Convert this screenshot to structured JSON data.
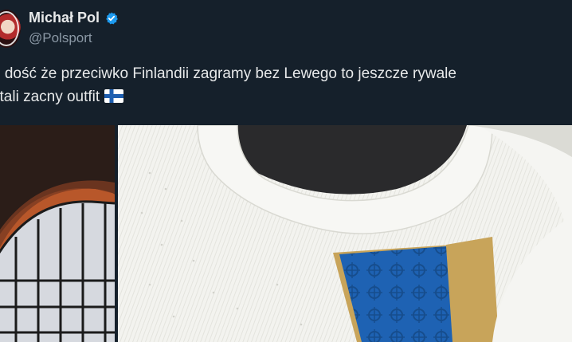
{
  "author": {
    "name": "Michał Pol",
    "handle": "@Polsport",
    "verified": true,
    "verified_color": "#1d9bf0"
  },
  "tweet": {
    "line1": "e dość że przeciwko Finlandii zagramy bez Lewego to jeszcze rywale",
    "line2": "stali zacny outfit",
    "emoji": "flag-finland-icon"
  },
  "media": {
    "images": [
      "church-window-photo",
      "finland-jersey-collar-photo"
    ]
  },
  "colors": {
    "background": "#15202b",
    "text": "#e7e9ea",
    "secondary_text": "#8b98a5",
    "jersey_white": "#f2f2ee",
    "jersey_blue": "#1d5fb0",
    "jersey_gold": "#c8a45a"
  }
}
